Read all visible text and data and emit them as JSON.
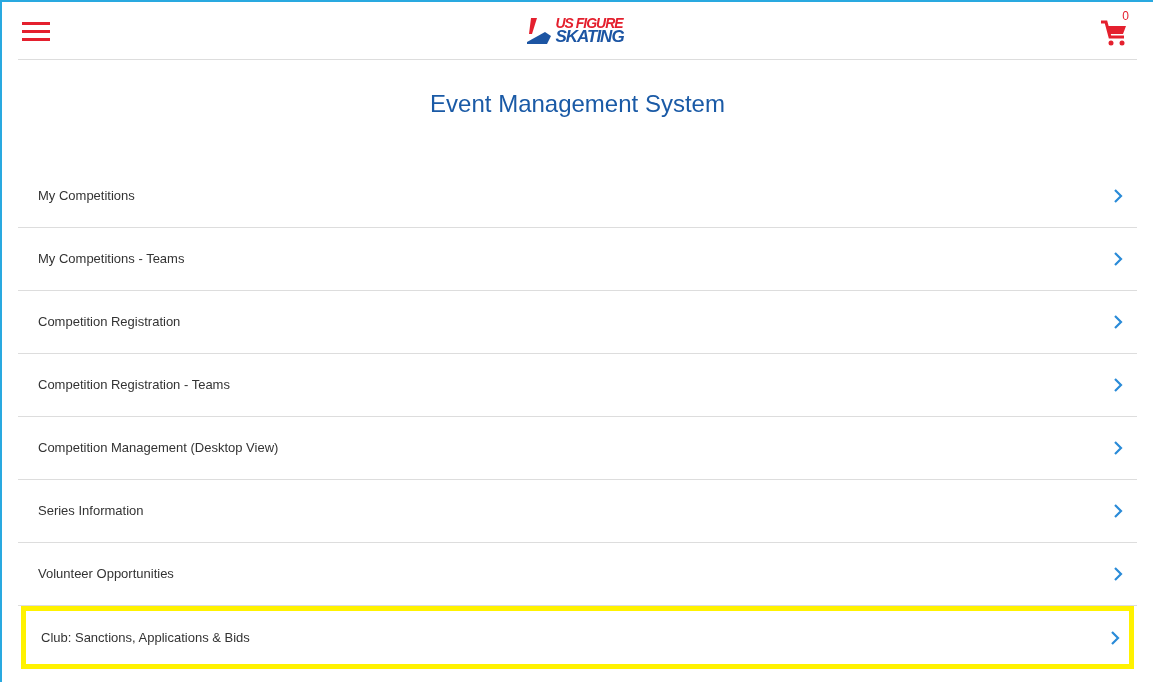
{
  "header": {
    "logo": {
      "line_1": "US FIGURE",
      "line_2": "SKATING"
    },
    "cart_count": "0"
  },
  "title": "Event Management System",
  "menu_items": [
    {
      "label": "My Competitions",
      "highlighted": false
    },
    {
      "label": "My Competitions - Teams",
      "highlighted": false
    },
    {
      "label": "Competition Registration",
      "highlighted": false
    },
    {
      "label": "Competition Registration - Teams",
      "highlighted": false
    },
    {
      "label": "Competition Management (Desktop View)",
      "highlighted": false
    },
    {
      "label": "Series Information",
      "highlighted": false
    },
    {
      "label": "Volunteer Opportunities",
      "highlighted": false
    },
    {
      "label": "Club: Sanctions, Applications & Bids",
      "highlighted": true
    }
  ]
}
